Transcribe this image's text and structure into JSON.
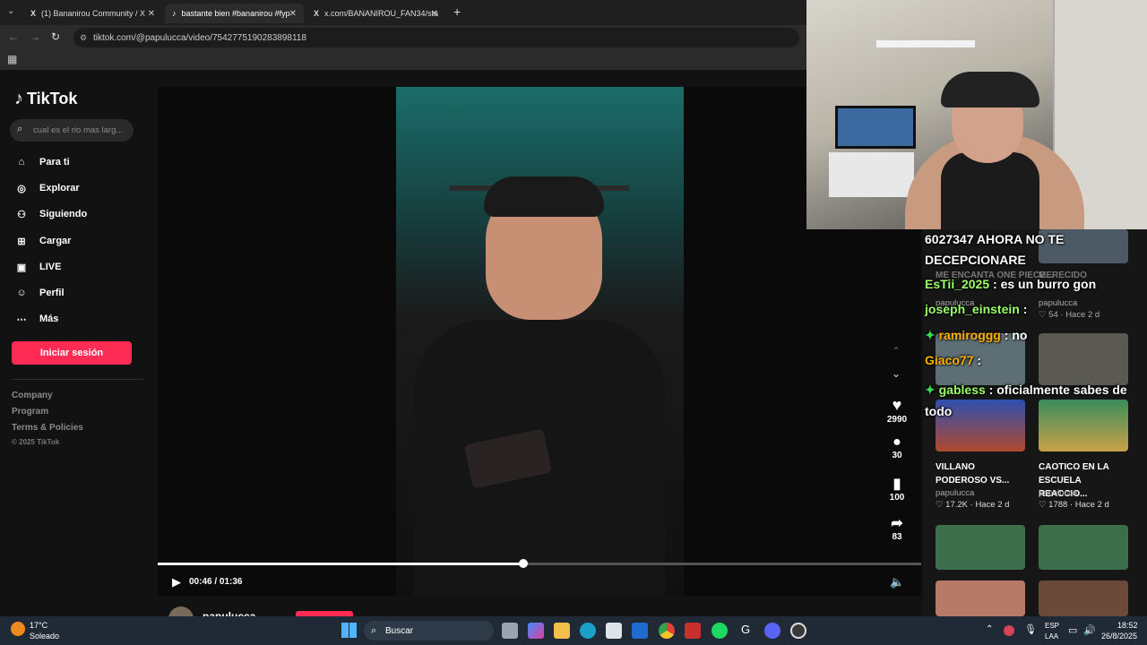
{
  "browser": {
    "tabs": [
      {
        "title": "(1) Bananirou Community / X",
        "active": false
      },
      {
        "title": "bastante bien #bananirou #fyp",
        "active": true
      },
      {
        "title": "x.com/BANANIROU_FAN34/sta",
        "active": false
      }
    ],
    "url": "tiktok.com/@papulucca/video/7542775190283898118"
  },
  "tiktok": {
    "logo": "TikTok",
    "search_placeholder": "cual es el rio mas larg...",
    "nav": [
      {
        "label": "Para ti",
        "icon": "home-icon"
      },
      {
        "label": "Explorar",
        "icon": "compass-icon"
      },
      {
        "label": "Siguiendo",
        "icon": "following-icon"
      },
      {
        "label": "Cargar",
        "icon": "upload-icon"
      },
      {
        "label": "LIVE",
        "icon": "live-icon"
      },
      {
        "label": "Perfil",
        "icon": "profile-icon"
      },
      {
        "label": "Más",
        "icon": "more-icon"
      }
    ],
    "login_button": "Iniciar sesión",
    "footer": [
      "Company",
      "Program",
      "Terms & Policies"
    ],
    "copyright": "© 2025 TikTok",
    "player": {
      "time": "00:46 / 01:36",
      "progress": 0.479
    },
    "actions": {
      "likes": "2990",
      "comments": "30",
      "saves": "100",
      "shares": "83"
    },
    "author": "papulucca"
  },
  "chat": {
    "lines": [
      {
        "user": "",
        "text": "6027347 AHORA NO TE DECEPCIONARE",
        "user_color": "#ffffff"
      },
      {
        "user": "EsTii_2025",
        "text": "es un burro gon",
        "user_color": "#9cff6a"
      },
      {
        "user": "joseph_einstein",
        "text": "",
        "user_color": "#9cff6a"
      },
      {
        "user": "ramiroggg",
        "text": "no",
        "user_color": "#ffb000"
      },
      {
        "user": "Giaco77",
        "text": "",
        "user_color": "#ffb000"
      },
      {
        "user": "gabless",
        "text": "oficialmente sabes de todo",
        "user_color": "#9cff6a"
      }
    ]
  },
  "related": [
    {
      "title": "ME ENCANTA ONE PIECE...",
      "author": "papulucca",
      "likes": "",
      "age": ""
    },
    {
      "title": "MERECIDO",
      "author": "papulucca",
      "likes": "54",
      "age": "Hace 2 d"
    },
    {
      "title": "VILLANO PODEROSO VS...",
      "author": "papulucca",
      "likes": "17.2K",
      "age": "Hace 2 d"
    },
    {
      "title": "CAOTICO EN LA ESCUELA REACCIO...",
      "author": "papulucca",
      "likes": "1788",
      "age": "Hace 2 d"
    }
  ],
  "taskbar": {
    "weather_temp": "17°C",
    "weather_desc": "Soleado",
    "search": "Buscar",
    "lang": "ESP",
    "lang2": "LAA",
    "time": "18:52",
    "date": "26/8/2025"
  }
}
